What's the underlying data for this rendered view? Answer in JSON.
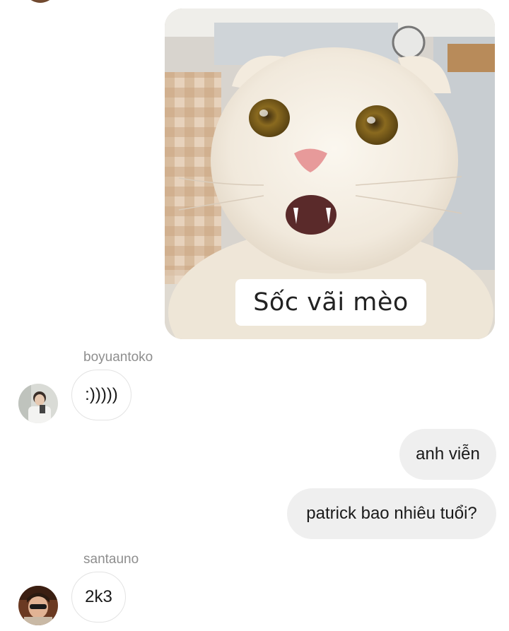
{
  "sticker": {
    "caption": "Sốc vãi mèo"
  },
  "messages": [
    {
      "sender": "boyuantoko",
      "text": ":)))))",
      "direction": "in"
    },
    {
      "text": "anh viễn",
      "direction": "out"
    },
    {
      "text": "patrick bao nhiêu tuổi?",
      "direction": "out"
    },
    {
      "sender": "santauno",
      "text": "2k3",
      "direction": "in"
    }
  ],
  "colors": {
    "incoming_bubble": "#ffffff",
    "outgoing_bubble": "#efefef",
    "sender_name": "#8e8e8e"
  }
}
